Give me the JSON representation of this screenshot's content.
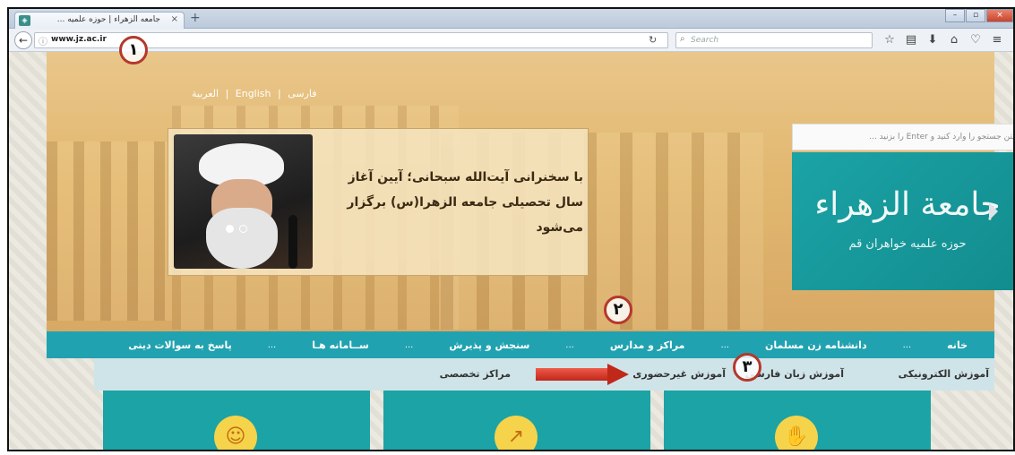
{
  "browser": {
    "tab_title": "جامعه الزهراء | حوزه علميه ...",
    "tab_close": "×",
    "new_tab": "+",
    "url_host": "www.jz.ac.ir",
    "search_placeholder": "Search",
    "window_buttons": [
      "–",
      "▫",
      "×"
    ]
  },
  "header": {
    "languages": [
      "فارسی",
      "English",
      "العربیة"
    ],
    "lang_separator": "|",
    "search_placeholder": "متن جستجو را وارد کنید و Enter را بزنید ...",
    "logo_main": "جامعة الزهراء",
    "logo_sub": "حوزه علمیه خواهران قم"
  },
  "slider": {
    "caption": "با سخنرانی آیت‌الله سبحانی؛ آیین آغاز سال تحصیلی جامعه الزهرا(س) برگزار می‌شود",
    "active_index": 0,
    "total": 2
  },
  "main_nav": {
    "items": [
      "خانه",
      "دانشنامه زن مسلمان",
      "مراکز و مدارس",
      "سنجش و پذیرش",
      "ســامانه هـا",
      "پاسخ به سوالات دینی"
    ],
    "more": "..."
  },
  "sub_nav": {
    "items": [
      "آموزش الکترونیکی",
      "آموزش زبان فارسی",
      "آموزش غیرحضوری",
      "مراکز تخصصی"
    ]
  },
  "annotations": [
    "١",
    "٢",
    "٣"
  ],
  "colors": {
    "teal": "#21a2b0",
    "accent_red": "#b5382c",
    "sand": "#e2b870"
  }
}
